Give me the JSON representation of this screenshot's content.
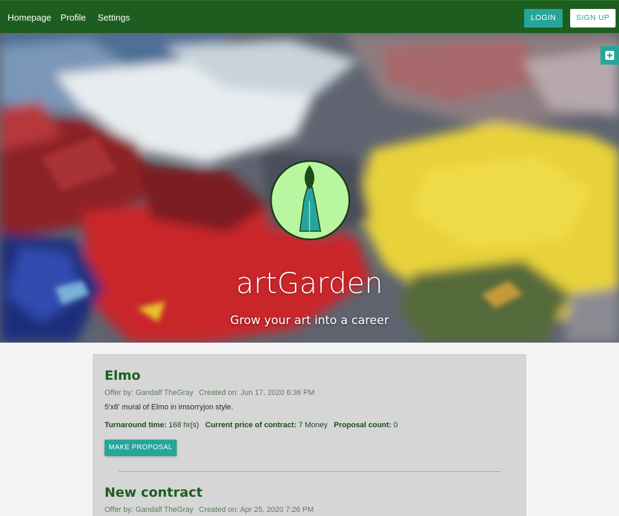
{
  "nav": {
    "links": [
      "Homepage",
      "Profile",
      "Settings"
    ],
    "login_label": "LOGIN",
    "signup_label": "SIGN UP"
  },
  "hero": {
    "title": "artGarden",
    "subtitle": "Grow your art into a career",
    "logo_icon": "paintbrush-icon",
    "add_icon": "plus-box-icon"
  },
  "contracts": [
    {
      "title": "Elmo",
      "offer_by": "Offer by: Gandalf TheGray",
      "created_on": "Created on: Jun 17, 2020 6:36 PM",
      "description": "5'x8' mural of Elmo in imsorryjon style.",
      "turnaround_label": "Turnaround time:",
      "turnaround_value": "168 hr(s)",
      "price_label": "Current price of contract:",
      "price_value": "7 Money",
      "proposal_label": "Proposal count:",
      "proposal_value": "0",
      "button_label": "MAKE PROPOSAL"
    },
    {
      "title": "New contract",
      "offer_by": "Offer by: Gandalf TheGray",
      "created_on": "Created on: Apr 25, 2020 7:26 PM"
    }
  ],
  "colors": {
    "nav_bg": "#1d5e20",
    "accent": "#26a69a",
    "title_green": "#1b5e20",
    "panel_bg": "#d6d6d6",
    "logo_fill": "#b9f6a0"
  }
}
